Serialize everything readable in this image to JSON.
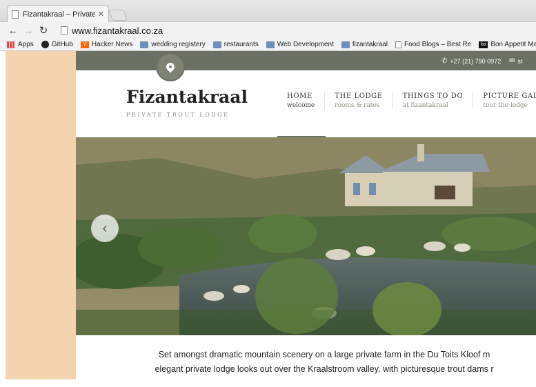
{
  "browser": {
    "tab_title": "Fizantakraal – Private Trout",
    "url": "www.fizantakraal.co.za",
    "bookmarks": [
      {
        "label": "Apps",
        "icon": "apps-icon"
      },
      {
        "label": "GitHub",
        "icon": "github-icon"
      },
      {
        "label": "Hacker News",
        "icon": "hacker-news-icon"
      },
      {
        "label": "wedding registery",
        "icon": "folder-icon"
      },
      {
        "label": "restaurants",
        "icon": "folder-icon"
      },
      {
        "label": "Web Development",
        "icon": "folder-icon"
      },
      {
        "label": "fizantakraal",
        "icon": "folder-icon"
      },
      {
        "label": "Food Blogs – Best Re",
        "icon": "page-icon"
      },
      {
        "label": "Bon Appetit Magazin",
        "icon": "bon-appetit-icon"
      }
    ]
  },
  "site": {
    "phone": "+27 (21) 790 0972",
    "email_short": "st",
    "logo": "Fizantakraal",
    "tagline": "PRIVATE TROUT LODGE",
    "nav": [
      {
        "title": "HOME",
        "sub": "welcome"
      },
      {
        "title": "THE LODGE",
        "sub": "rooms & rates"
      },
      {
        "title": "THINGS TO DO",
        "sub": "at fizantakraal"
      },
      {
        "title": "PICTURE GALLERY",
        "sub": "tour the lodge"
      }
    ],
    "intro_line1": "Set amongst dramatic mountain scenery on a large private farm in the Du Toits Kloof m",
    "intro_line2": "elegant private lodge looks out over the Kraalstroom valley, with picturesque trout dams r"
  },
  "colors": {
    "topbar": "#6b7062",
    "page_bg": "#f4d4ae"
  }
}
